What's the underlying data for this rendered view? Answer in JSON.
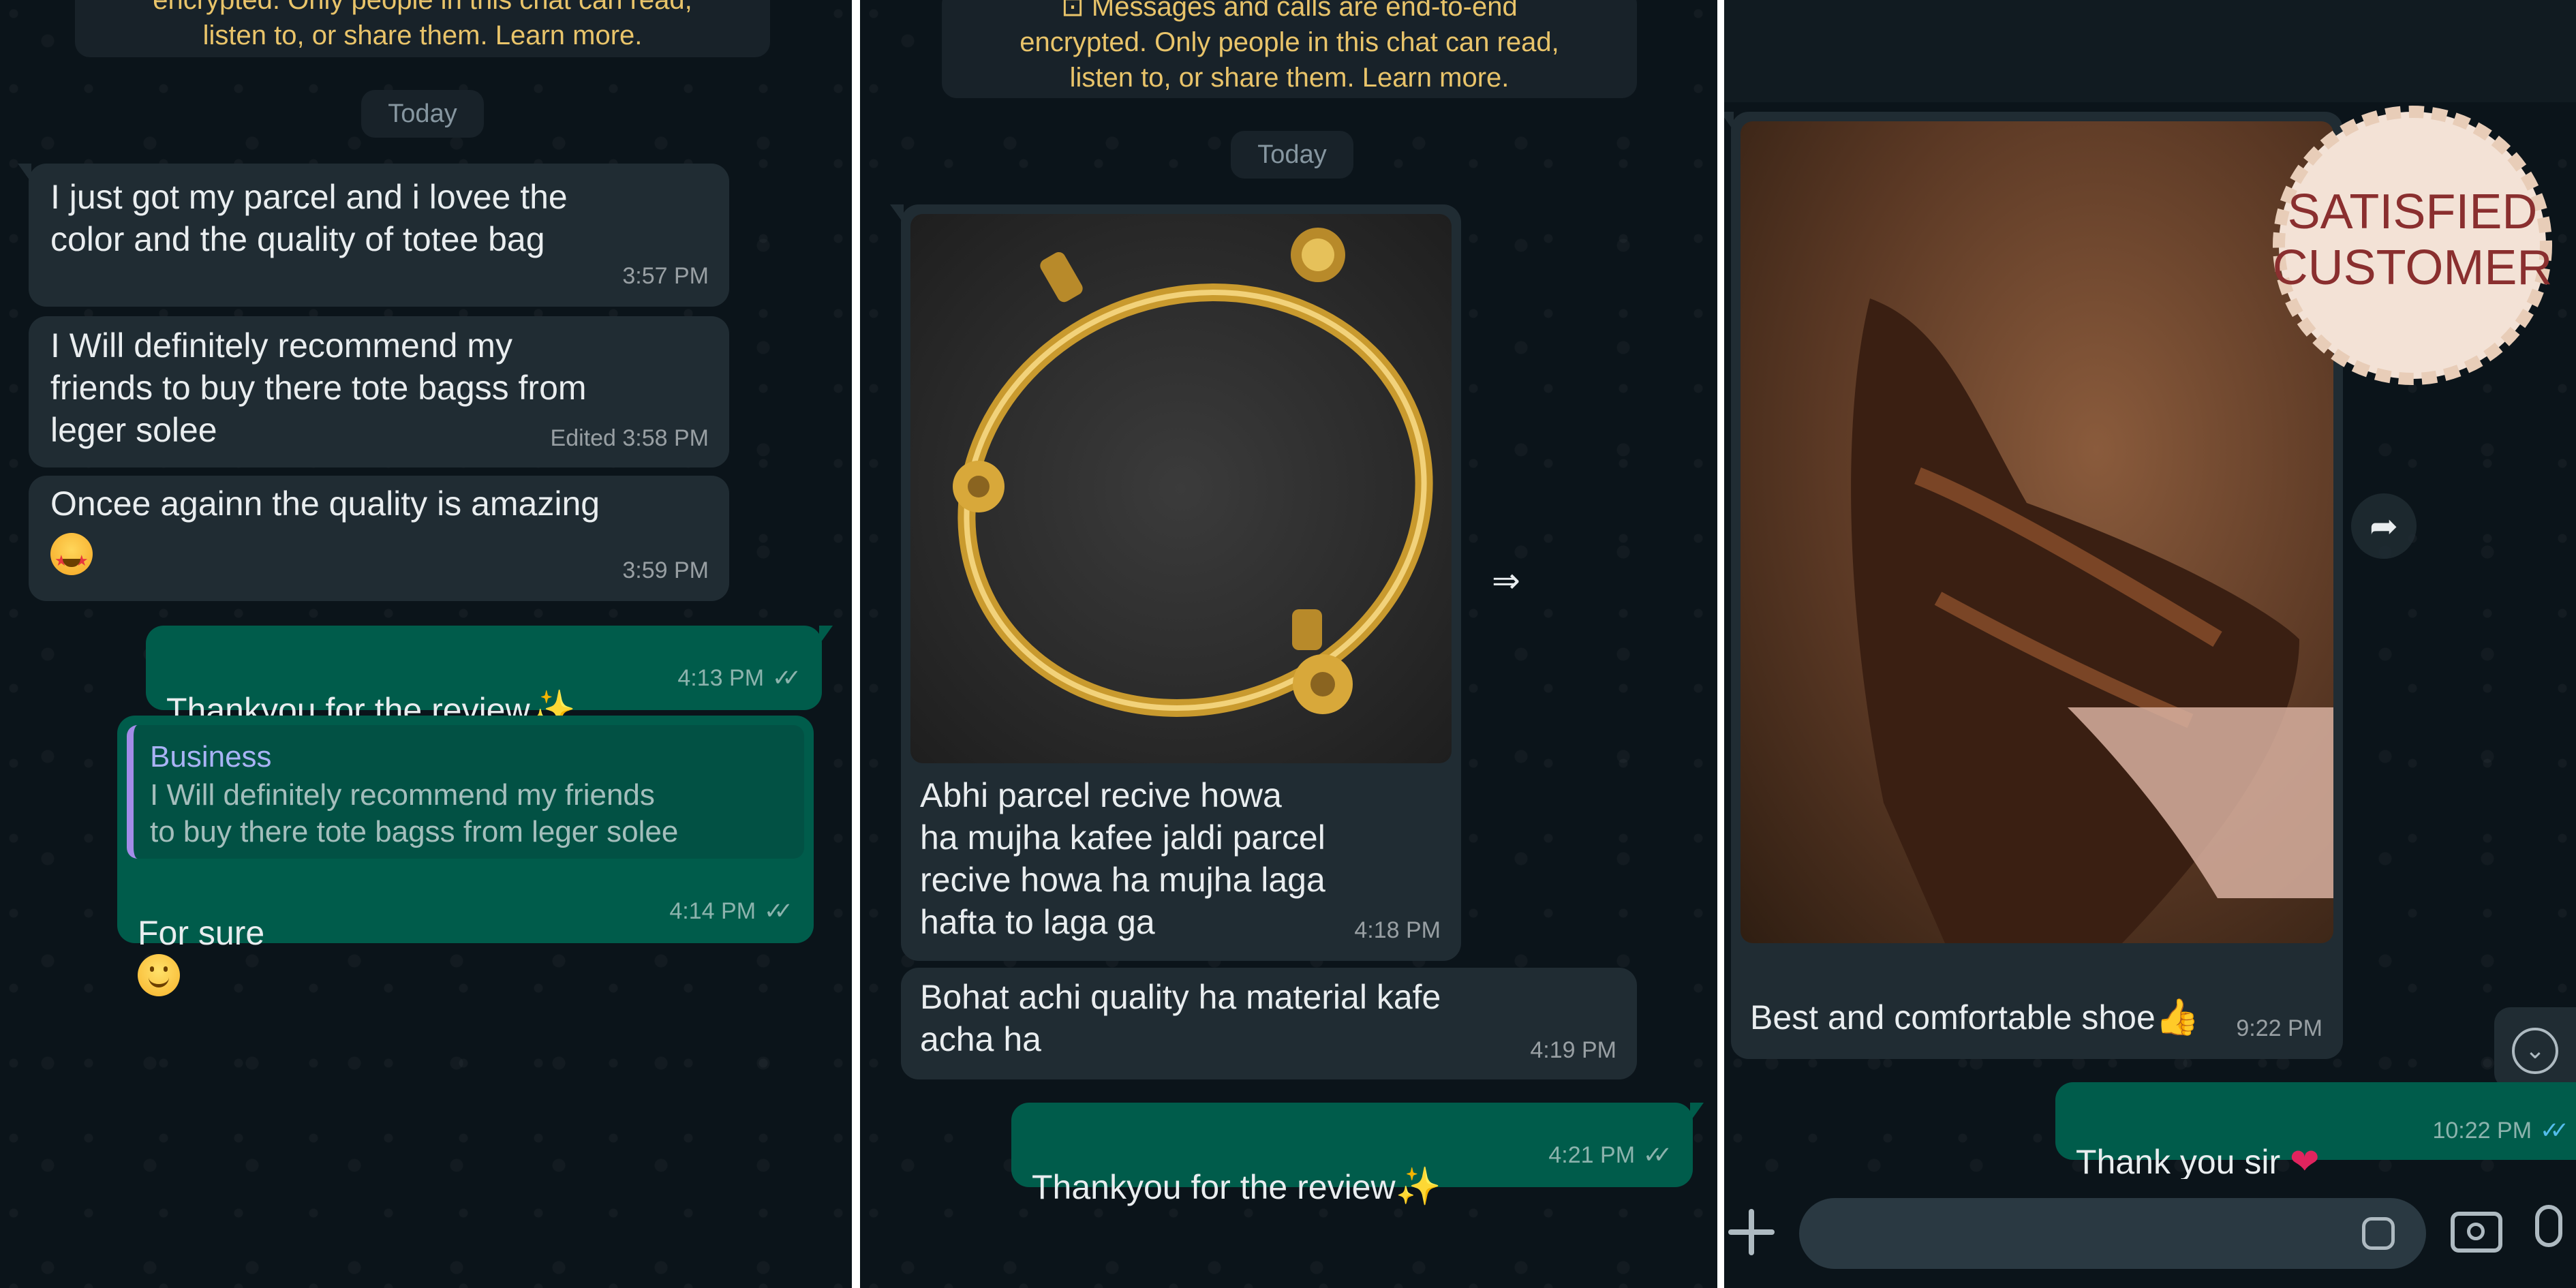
{
  "panel1": {
    "system_note": [
      "encrypted. Only people in this chat can read,",
      "listen to, or share them. Learn more."
    ],
    "date_chip": "Today",
    "messages": [
      {
        "text": "I just got my parcel and i lovee the\ncolor and the quality of totee bag",
        "time": "3:57 PM"
      },
      {
        "text": "I Will definitely recommend my\nfriends to buy there tote bagss from\nleger solee",
        "time": "Edited 3:58 PM"
      },
      {
        "text": "Oncee againn the quality is amazing",
        "time": "3:59 PM",
        "emoji": "star-struck"
      },
      {
        "text": "Thankyou for the review",
        "time": "4:13 PM",
        "emoji": "sparkles"
      },
      {
        "quote_author": "Business",
        "quote_text": "I Will definitely recommend my friends\nto buy there tote bagss from leger solee",
        "text": "For sure",
        "time": "4:14 PM",
        "emoji": "slightly-smiling"
      }
    ]
  },
  "panel2": {
    "system_note": [
      "⊡ Messages and calls are end-to-end",
      "encrypted. Only people in this chat can read,",
      "listen to, or share them. Learn more."
    ],
    "date_chip": "Today",
    "image_caption": "Abhi parcel recive howa\nha mujha kafee jaldi parcel\nrecive howa ha mujha laga\nhafta to laga ga",
    "image_time": "4:18 PM",
    "image_subject": "gold bangle with charms",
    "messages": [
      {
        "text": "Bohat achi quality ha material kafe\nacha ha",
        "time": "4:19 PM"
      },
      {
        "text": "Thankyou for the review",
        "time": "4:21 PM",
        "emoji": "sparkles"
      }
    ]
  },
  "panel3": {
    "badge_text": [
      "SATISFIED",
      "CUSTOMER"
    ],
    "image_subject": "brown leather shoe",
    "image_caption": "Best and comfortable shoe",
    "image_time": "9:22 PM",
    "caption_emoji": "thumbs-up",
    "messages": [
      {
        "text": "Thank you sir",
        "time": "10:22 PM",
        "emoji": "red-heart"
      }
    ]
  },
  "icons": {
    "forward": "forward-icon",
    "attach": "plus-icon",
    "sticker": "sticker-icon",
    "camera": "camera-icon",
    "mic": "mic-icon",
    "scroll_down": "chevron-down-icon",
    "double_tick": "double-tick-icon"
  },
  "colors": {
    "background": "#0b141a",
    "incoming_bubble": "#202c33",
    "outgoing_bubble": "#005c4b",
    "text": "#e9edef",
    "system_note_text": "#e9c46a",
    "read_ticks": "#53bdeb",
    "badge_text": "#8a2f2f"
  }
}
